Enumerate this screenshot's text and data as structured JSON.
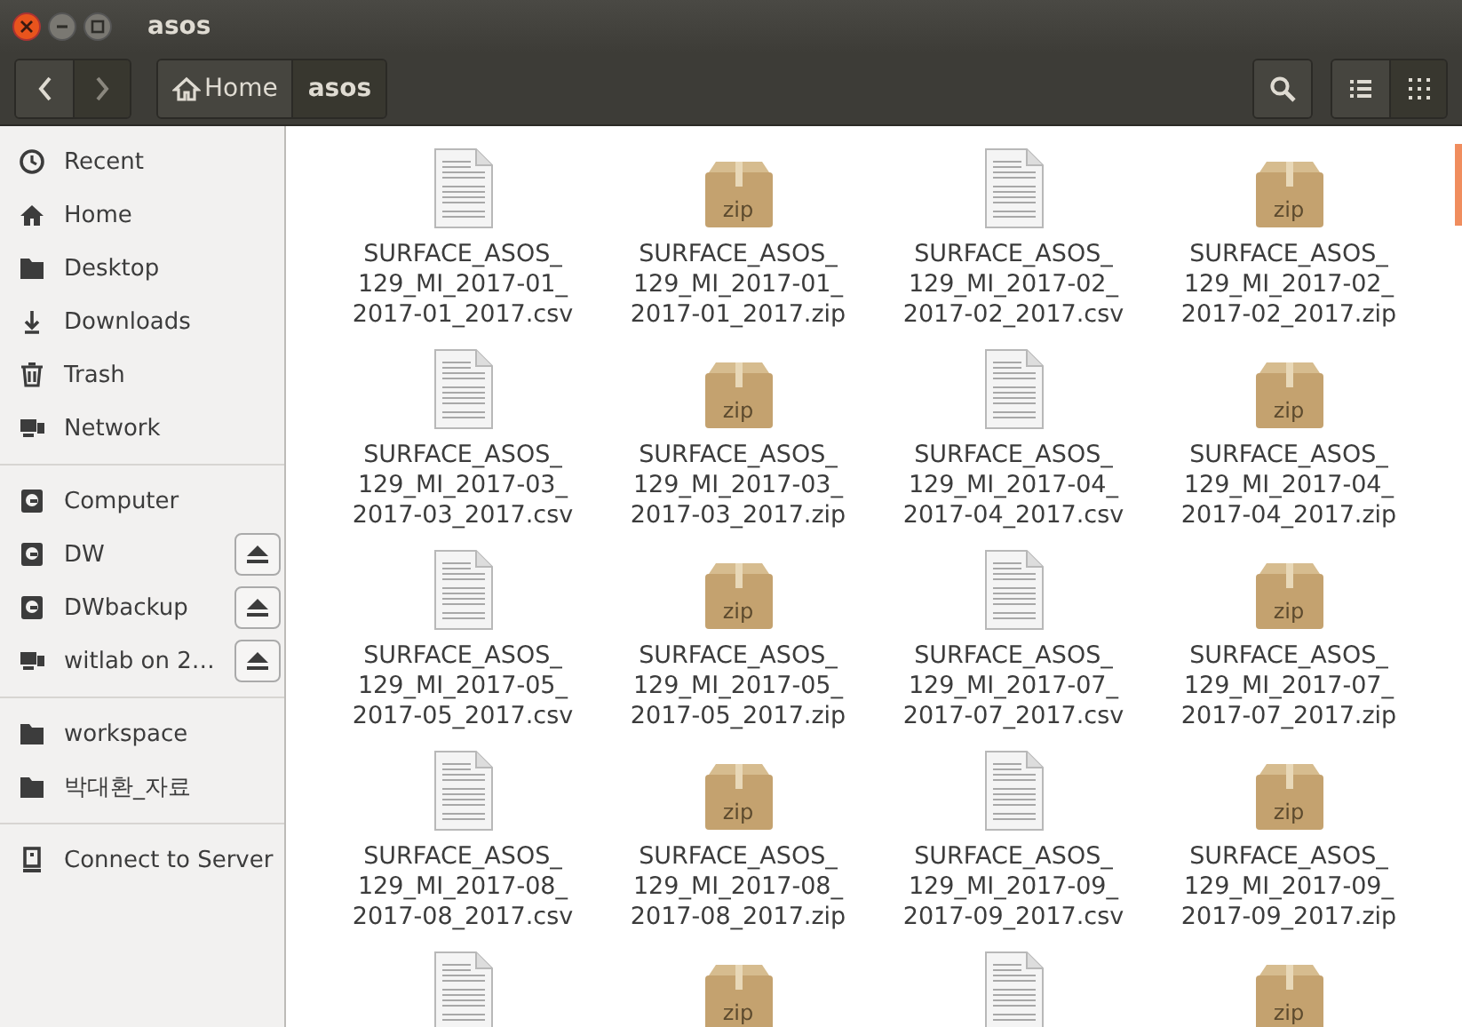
{
  "window": {
    "title": "asos"
  },
  "path_bar": [
    {
      "label": "Home",
      "kind": "home",
      "selected": false
    },
    {
      "label": "asos",
      "kind": "folder",
      "selected": true
    }
  ],
  "view_buttons": [
    {
      "kind": "list",
      "selected": false
    },
    {
      "kind": "grid",
      "selected": true
    }
  ],
  "sidebar": {
    "groups": [
      {
        "items": [
          {
            "label": "Recent",
            "kind": "recent",
            "ejectable": false
          },
          {
            "label": "Home",
            "kind": "home",
            "ejectable": false
          },
          {
            "label": "Desktop",
            "kind": "folder",
            "ejectable": false
          },
          {
            "label": "Downloads",
            "kind": "download",
            "ejectable": false
          },
          {
            "label": "Trash",
            "kind": "trash",
            "ejectable": false
          },
          {
            "label": "Network",
            "kind": "network",
            "ejectable": false
          }
        ]
      },
      {
        "items": [
          {
            "label": "Computer",
            "kind": "drive",
            "ejectable": false
          },
          {
            "label": "DW",
            "kind": "drive",
            "ejectable": true
          },
          {
            "label": "DWbackup",
            "kind": "drive",
            "ejectable": true
          },
          {
            "label": "witlab on 2…",
            "kind": "network",
            "ejectable": true
          }
        ]
      },
      {
        "items": [
          {
            "label": "workspace",
            "kind": "folder",
            "ejectable": false
          },
          {
            "label": "박대환_자료",
            "kind": "folder",
            "ejectable": false
          }
        ]
      },
      {
        "items": [
          {
            "label": "Connect to Server",
            "kind": "server",
            "ejectable": false
          }
        ]
      }
    ]
  },
  "files": [
    {
      "kind": "text",
      "name": "SURFACE_ASOS_\n129_MI_2017-01_\n2017-01_2017.csv"
    },
    {
      "kind": "zip",
      "badge": "zip",
      "name": "SURFACE_ASOS_\n129_MI_2017-01_\n2017-01_2017.zip"
    },
    {
      "kind": "text",
      "name": "SURFACE_ASOS_\n129_MI_2017-02_\n2017-02_2017.csv"
    },
    {
      "kind": "zip",
      "badge": "zip",
      "name": "SURFACE_ASOS_\n129_MI_2017-02_\n2017-02_2017.zip"
    },
    {
      "kind": "text",
      "name": "SURFACE_ASOS_\n129_MI_2017-03_\n2017-03_2017.csv"
    },
    {
      "kind": "zip",
      "badge": "zip",
      "name": "SURFACE_ASOS_\n129_MI_2017-03_\n2017-03_2017.zip"
    },
    {
      "kind": "text",
      "name": "SURFACE_ASOS_\n129_MI_2017-04_\n2017-04_2017.csv"
    },
    {
      "kind": "zip",
      "badge": "zip",
      "name": "SURFACE_ASOS_\n129_MI_2017-04_\n2017-04_2017.zip"
    },
    {
      "kind": "text",
      "name": "SURFACE_ASOS_\n129_MI_2017-05_\n2017-05_2017.csv"
    },
    {
      "kind": "zip",
      "badge": "zip",
      "name": "SURFACE_ASOS_\n129_MI_2017-05_\n2017-05_2017.zip"
    },
    {
      "kind": "text",
      "name": "SURFACE_ASOS_\n129_MI_2017-07_\n2017-07_2017.csv"
    },
    {
      "kind": "zip",
      "badge": "zip",
      "name": "SURFACE_ASOS_\n129_MI_2017-07_\n2017-07_2017.zip"
    },
    {
      "kind": "text",
      "name": "SURFACE_ASOS_\n129_MI_2017-08_\n2017-08_2017.csv"
    },
    {
      "kind": "zip",
      "badge": "zip",
      "name": "SURFACE_ASOS_\n129_MI_2017-08_\n2017-08_2017.zip"
    },
    {
      "kind": "text",
      "name": "SURFACE_ASOS_\n129_MI_2017-09_\n2017-09_2017.csv"
    },
    {
      "kind": "zip",
      "badge": "zip",
      "name": "SURFACE_ASOS_\n129_MI_2017-09_\n2017-09_2017.zip"
    },
    {
      "kind": "text"
    },
    {
      "kind": "zip",
      "badge": "zip"
    },
    {
      "kind": "text"
    },
    {
      "kind": "zip",
      "badge": "zip"
    }
  ]
}
